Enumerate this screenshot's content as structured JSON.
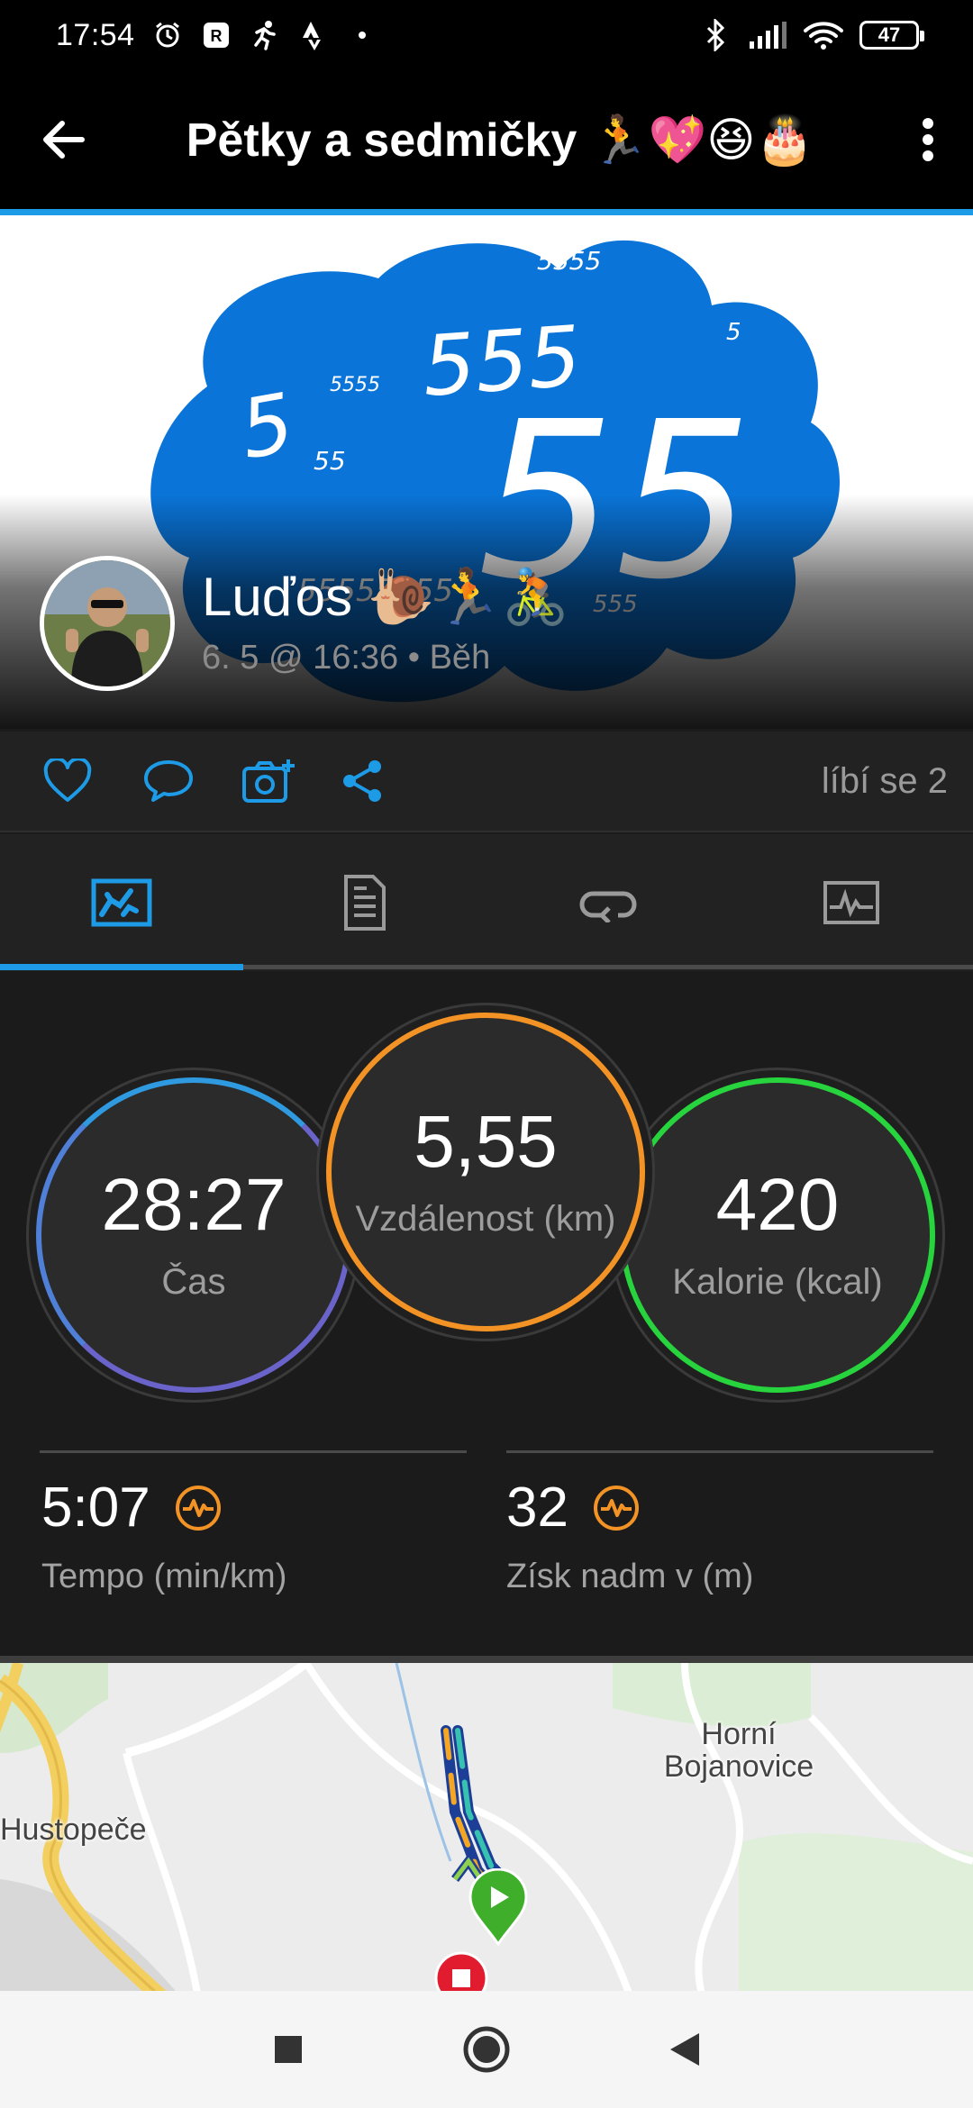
{
  "status_bar": {
    "time": "17:54",
    "battery": "47",
    "icons": [
      "alarm-icon",
      "app-icon",
      "running-icon",
      "strava-icon",
      "dot-icon",
      "bluetooth-icon",
      "signal-icon",
      "wifi-icon",
      "battery-icon"
    ]
  },
  "app_bar": {
    "title": "Pětky a sedmičky 🏃💖😆🎂",
    "back_icon": "arrow-left-icon",
    "more_icon": "more-vertical-icon"
  },
  "hero": {
    "cloud_numbers": [
      "5555",
      "5555",
      "555",
      "5",
      "5",
      "55",
      "55",
      "55555555",
      "555"
    ],
    "cloud_color": "#0a74d8",
    "user_name": "Luďos 🐌🏃🚴",
    "meta": "6. 5 @ 16:36 • Běh"
  },
  "actions": {
    "icons": [
      "heart-icon",
      "comment-icon",
      "add-photo-icon",
      "share-icon"
    ],
    "likes": "líbí se 2"
  },
  "tabs": [
    "overview-tab",
    "details-tab",
    "laps-tab",
    "charts-tab"
  ],
  "stats": {
    "time_value": "28:27",
    "time_label": "Čas",
    "distance_value": "5,55",
    "distance_label": "Vzdálenost (km)",
    "calories_value": "420",
    "calories_label": "Kalorie (kcal)",
    "pace_value": "5:07",
    "pace_label": "Tempo (min/km)",
    "elev_value": "32",
    "elev_label": "Získ nadm v (m)"
  },
  "map": {
    "labels": {
      "town1": "Horní\nBojanovice",
      "town2": "Hustopeče"
    }
  },
  "colors": {
    "accent": "#1e9be6",
    "time_ring": "#6a63c9",
    "distance_ring": "#f39325",
    "calories_ring": "#27d43d",
    "hr_icon": "#f39325"
  }
}
